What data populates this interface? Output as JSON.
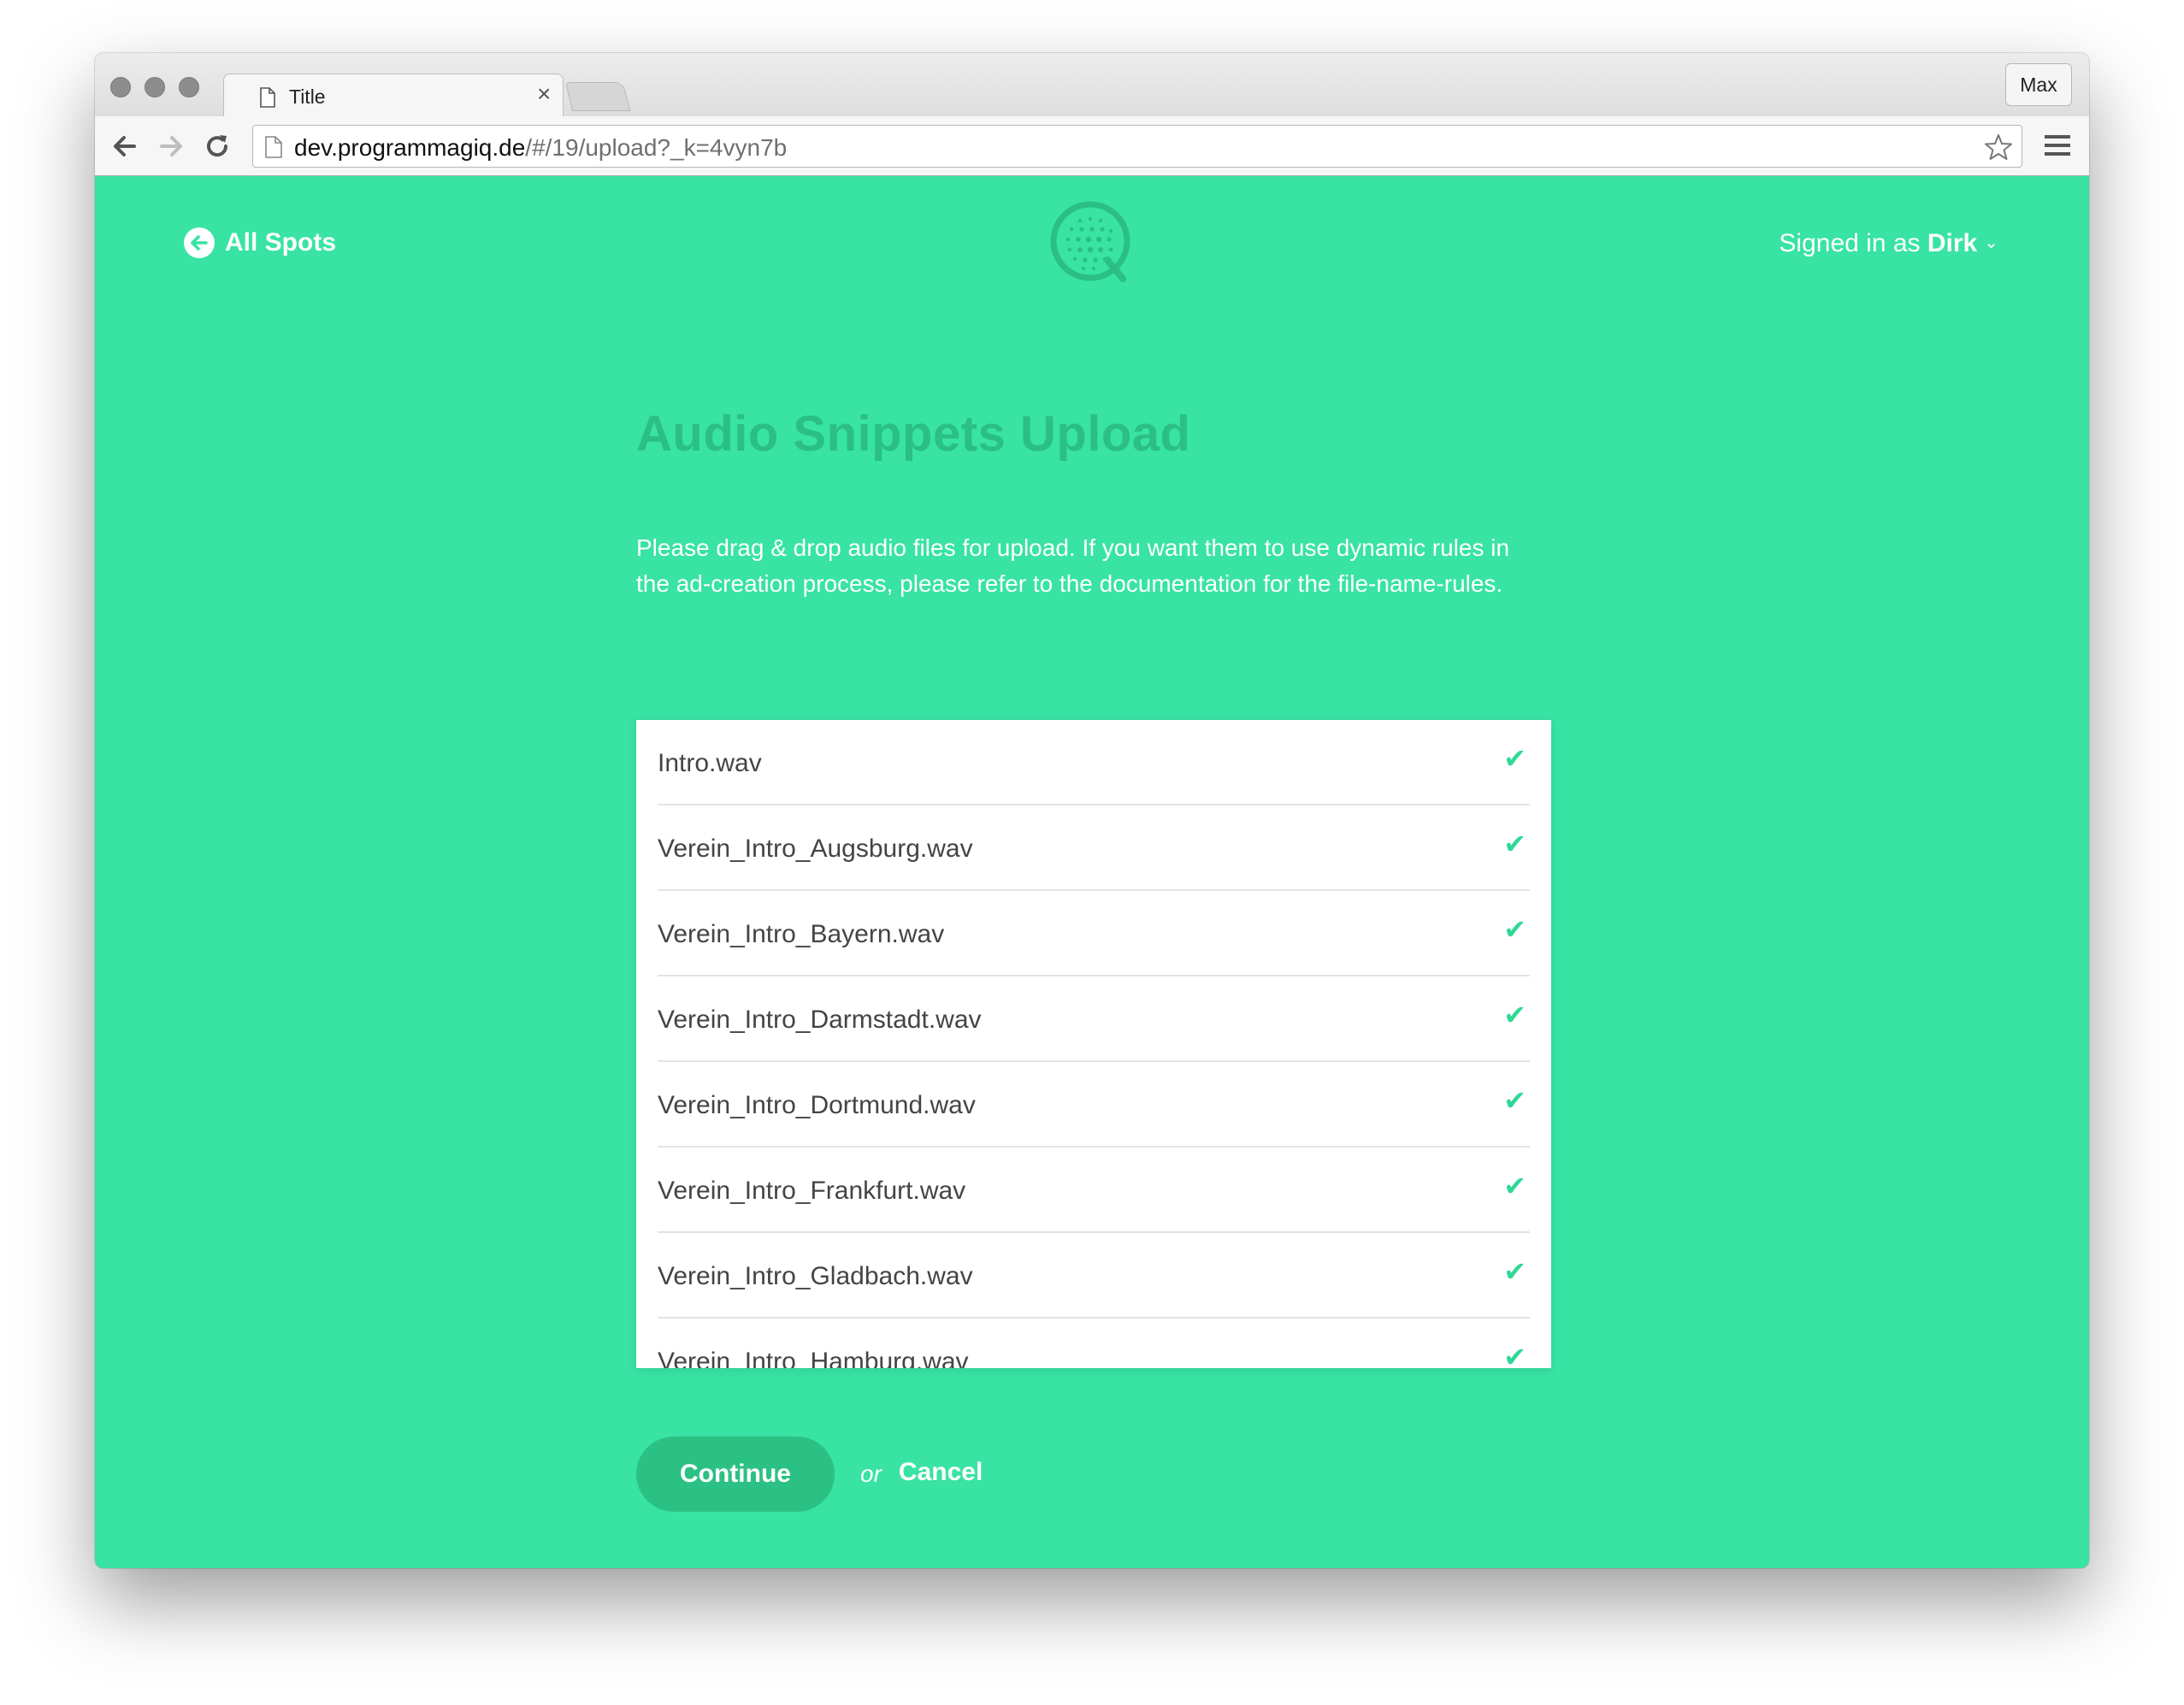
{
  "browser": {
    "tab_title": "Title",
    "tab_close": "×",
    "profile_label": "Max",
    "url_host": "dev.programmagiq.de",
    "url_path": "/#/19/upload?_k=4vyn7b"
  },
  "header": {
    "back_label": "All Spots",
    "signed_in_prefix": "Signed in as",
    "user_name": "Dirk",
    "chevron": "⌄"
  },
  "main": {
    "title": "Audio Snippets Upload",
    "description": "Please drag & drop audio files for upload. If you want them to use dynamic rules in the ad-creation process, please refer to the documentation for the file-name-rules.",
    "files": [
      {
        "name": "Intro.wav",
        "status": "✔"
      },
      {
        "name": "Verein_Intro_Augsburg.wav",
        "status": "✔"
      },
      {
        "name": "Verein_Intro_Bayern.wav",
        "status": "✔"
      },
      {
        "name": "Verein_Intro_Darmstadt.wav",
        "status": "✔"
      },
      {
        "name": "Verein_Intro_Dortmund.wav",
        "status": "✔"
      },
      {
        "name": "Verein_Intro_Frankfurt.wav",
        "status": "✔"
      },
      {
        "name": "Verein_Intro_Gladbach.wav",
        "status": "✔"
      },
      {
        "name": "Verein_Intro_Hamburg.wav",
        "status": "✔"
      }
    ],
    "continue_label": "Continue",
    "or_label": "or",
    "cancel_label": "Cancel"
  },
  "colors": {
    "background": "#38e3a4",
    "accent_dark": "#2cc184",
    "check": "#2fd995"
  }
}
